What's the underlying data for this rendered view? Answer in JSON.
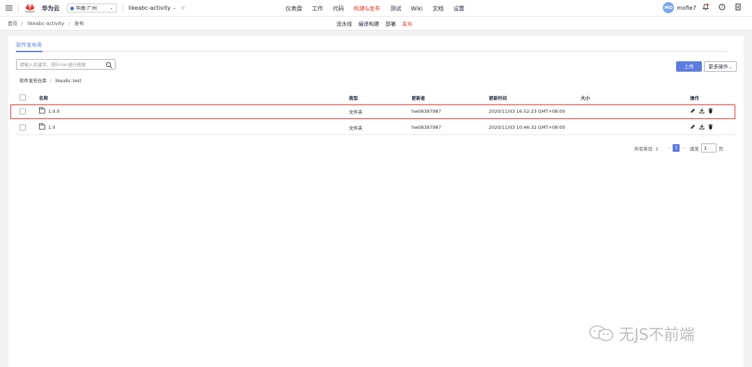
{
  "header": {
    "brand_small": "HUAWEI",
    "brand": "华为云",
    "region": "华南-广州",
    "project": "likeabc-activity",
    "nav": [
      {
        "label": "仪表盘",
        "active": false
      },
      {
        "label": "工作",
        "active": false
      },
      {
        "label": "代码",
        "active": false
      },
      {
        "label": "构建&发布",
        "active": true
      },
      {
        "label": "测试",
        "active": false
      },
      {
        "label": "Wiki",
        "active": false
      },
      {
        "label": "文档",
        "active": false
      },
      {
        "label": "设置",
        "active": false
      }
    ],
    "user_initials": "MO",
    "username": "mofie7"
  },
  "subbar": {
    "breadcrumb": [
      "首页",
      "likeabc-activity",
      "发布"
    ],
    "nav": [
      {
        "label": "流水线",
        "active": false
      },
      {
        "label": "编译构建",
        "active": false
      },
      {
        "label": "部署",
        "active": false
      },
      {
        "label": "发布",
        "active": true
      }
    ]
  },
  "main": {
    "tab": "软件发布库",
    "search_placeholder": "请输入关键字，按Enter进行搜索",
    "upload_label": "上传",
    "more_label": "更多操作",
    "path": [
      "软件发布仓库",
      "likeabc-test"
    ],
    "columns": {
      "name": "名称",
      "type": "类型",
      "updater": "更新者",
      "time": "更新时间",
      "size": "大小",
      "ops": "操作"
    },
    "rows": [
      {
        "name": "1.0.0",
        "type": "文件夹",
        "updater": "hw08387987",
        "time": "2020/11/03 16:52:23 GMT+08:00",
        "size": ""
      },
      {
        "name": "1.0",
        "type": "文件夹",
        "updater": "hw08387987",
        "time": "2020/11/03 10:46:32 GMT+08:00",
        "size": ""
      }
    ],
    "pager": {
      "total_label": "所有条目: 2",
      "current": "1",
      "goto_label": "跳至",
      "goto_value": "1",
      "page_unit": "页"
    }
  },
  "watermark": "无JS不前端",
  "colors": {
    "accent": "#5e7ce0",
    "active_nav": "#e0402f",
    "highlight_border": "#e0302a"
  }
}
